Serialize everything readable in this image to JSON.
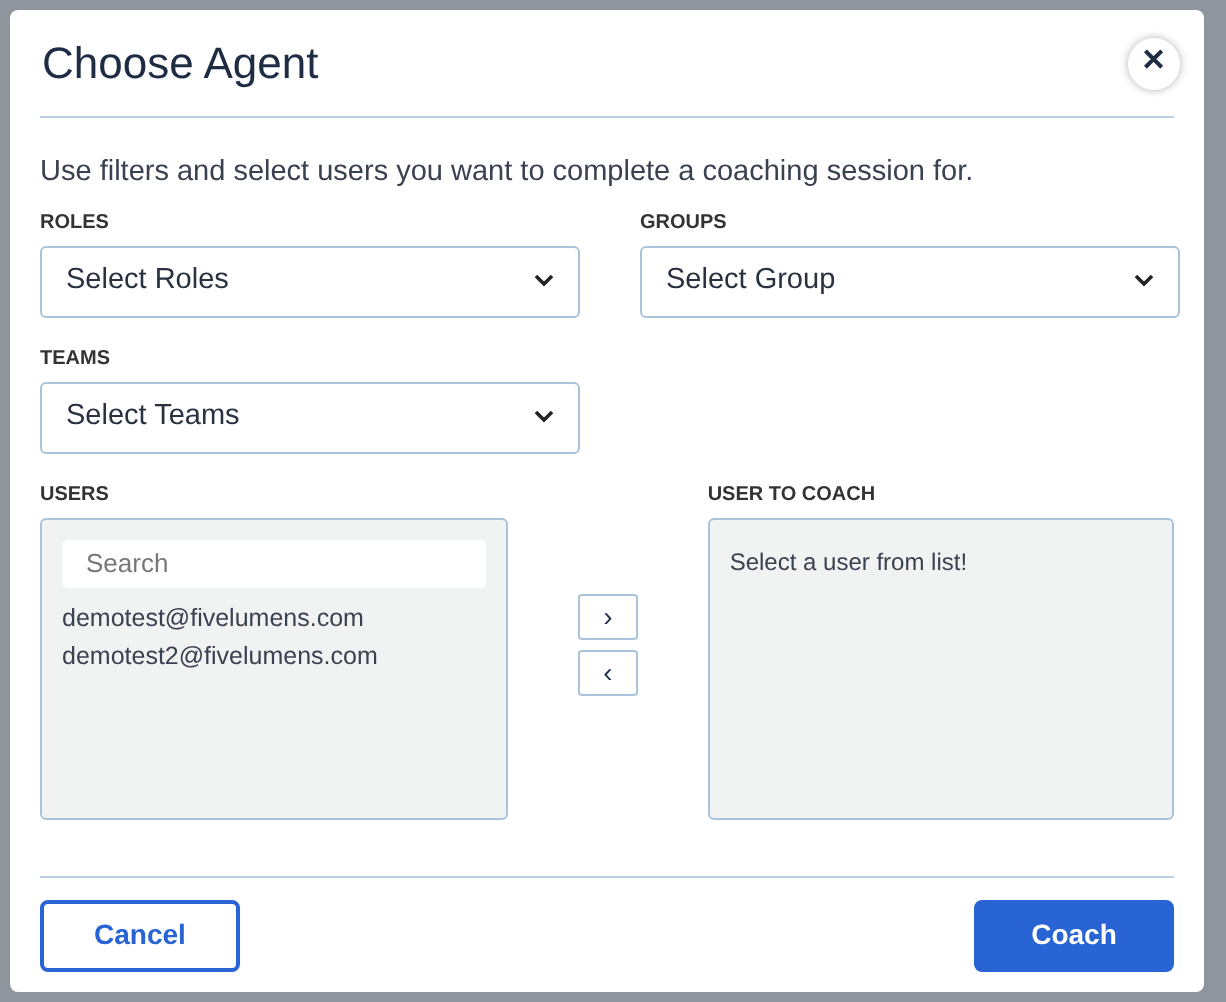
{
  "dialog": {
    "title": "Choose Agent",
    "close": "✕"
  },
  "intro": "Use filters and select users you want to complete a coaching session for.",
  "filters": [
    {
      "label": "ROLES",
      "value": "Select Roles"
    },
    {
      "label": "GROUPS",
      "value": "Select Group"
    },
    {
      "label": "TEAMS",
      "value": "Select Teams"
    }
  ],
  "users": {
    "label": "USERS",
    "search_placeholder": "Search",
    "items": [
      "demotest@fivelumens.com",
      "demotest2@fivelumens.com"
    ]
  },
  "move_buttons": [
    "›",
    "‹"
  ],
  "user_to_coach": {
    "label": "USER TO COACH",
    "empty_text": "Select a user from list!"
  },
  "buttons": [
    {
      "label": "Cancel",
      "kind": "secondary"
    },
    {
      "label": "Coach",
      "kind": "primary"
    }
  ]
}
